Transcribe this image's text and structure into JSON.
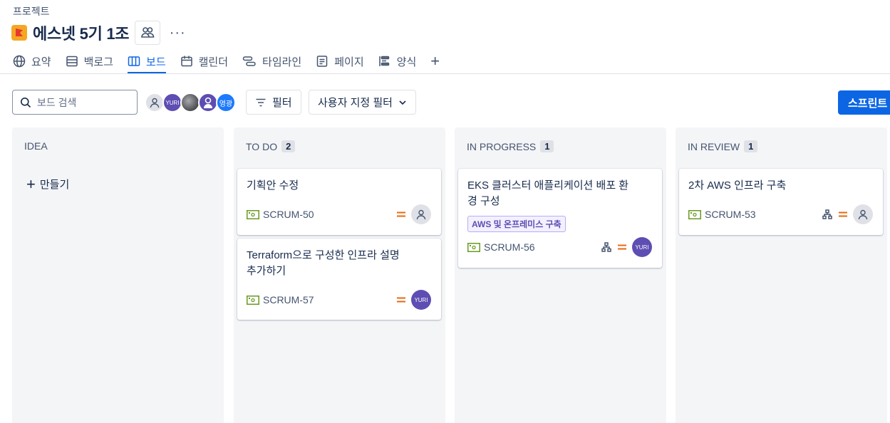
{
  "breadcrumb": "프로젝트",
  "project": {
    "title": "에스넷 5기 1조",
    "more": "···"
  },
  "tabs": [
    {
      "label": "요약"
    },
    {
      "label": "백로그"
    },
    {
      "label": "보드"
    },
    {
      "label": "캘린더"
    },
    {
      "label": "타임라인"
    },
    {
      "label": "페이지"
    },
    {
      "label": "양식"
    }
  ],
  "tab_add": "+",
  "toolbar": {
    "search_placeholder": "보드 검색",
    "avatars": [
      {
        "text": ""
      },
      {
        "text": "YURI"
      },
      {
        "text": ""
      },
      {
        "text": ""
      },
      {
        "text": "영광"
      }
    ],
    "filter_label": "필터",
    "custom_filter_label": "사용자 지정 필터",
    "sprint_label": "스프린트"
  },
  "columns": [
    {
      "name": "IDEA",
      "count": "",
      "create_label": "만들기",
      "cards": []
    },
    {
      "name": "TO DO",
      "count": "2",
      "cards": [
        {
          "title": "기획안 수정",
          "key": "SCRUM-50",
          "assignee": ""
        },
        {
          "title": "Terraform으로 구성한 인프라 설명 추가하기",
          "key": "SCRUM-57",
          "assignee": "YURI"
        }
      ]
    },
    {
      "name": "IN PROGRESS",
      "count": "1",
      "cards": [
        {
          "title": "EKS 클러스터 애플리케이션 배포 환경 구성",
          "epic": "AWS 및 온프레미스 구축",
          "key": "SCRUM-56",
          "assignee": "YURI"
        }
      ]
    },
    {
      "name": "IN REVIEW",
      "count": "1",
      "cards": [
        {
          "title": "2차 AWS 인프라 구축",
          "key": "SCRUM-53",
          "assignee": ""
        }
      ]
    }
  ],
  "colors": {
    "accent": "#0c66e4",
    "priority": "#e56910",
    "epic_purple": "#5e4db2",
    "story_green": "#6a9a23"
  }
}
